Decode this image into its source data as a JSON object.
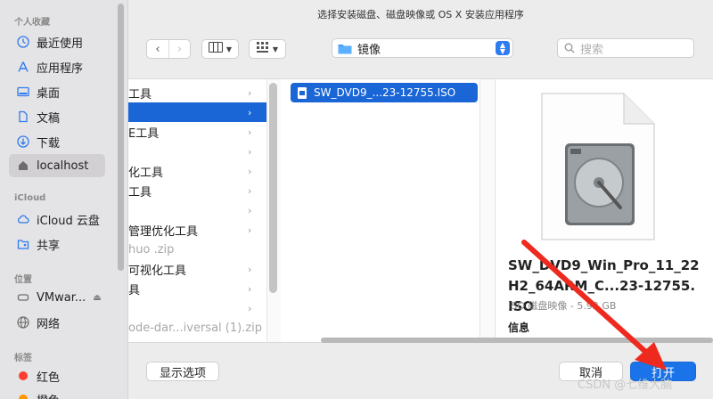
{
  "dialog": {
    "title": "选择安装磁盘、磁盘映像或 OS X 安装应用程序"
  },
  "sidebar": {
    "sections": [
      {
        "label": "个人收藏"
      },
      {
        "label": "iCloud"
      },
      {
        "label": "位置"
      },
      {
        "label": "标签"
      }
    ],
    "favorites": [
      {
        "label": "最近使用",
        "icon": "clock-icon"
      },
      {
        "label": "应用程序",
        "icon": "applications-icon"
      },
      {
        "label": "桌面",
        "icon": "desktop-icon"
      },
      {
        "label": "文稿",
        "icon": "document-icon"
      },
      {
        "label": "下载",
        "icon": "download-icon"
      },
      {
        "label": "localhost",
        "icon": "home-icon"
      }
    ],
    "icloud": [
      {
        "label": "iCloud 云盘",
        "icon": "cloud-icon"
      },
      {
        "label": "共享",
        "icon": "shared-folder-icon"
      }
    ],
    "locations": [
      {
        "label": "VMwar...",
        "icon": "disk-icon"
      },
      {
        "label": "网络",
        "icon": "network-icon"
      }
    ],
    "tags": [
      {
        "label": "红色",
        "color": "#ff3b30"
      },
      {
        "label": "橙色",
        "color": "#ff9500"
      }
    ]
  },
  "toolbar": {
    "location": "镜像",
    "search_placeholder": "搜索"
  },
  "column1": [
    {
      "label": "工具",
      "selected": false,
      "chevron": true
    },
    {
      "label": "",
      "selected": true,
      "chevron": true
    },
    {
      "label": "E工具",
      "selected": false,
      "chevron": true
    },
    {
      "label": "",
      "selected": false,
      "chevron": true
    },
    {
      "label": "化工具",
      "selected": false,
      "chevron": true
    },
    {
      "label": "工具",
      "selected": false,
      "chevron": true
    },
    {
      "label": "",
      "selected": false,
      "chevron": true
    },
    {
      "label": "管理优化工具",
      "selected": false,
      "chevron": true
    },
    {
      "label": "huo .zip",
      "selected": false,
      "chevron": false,
      "grey": true
    },
    {
      "label": "可视化工具",
      "selected": false,
      "chevron": true
    },
    {
      "label": "具",
      "selected": false,
      "chevron": true
    },
    {
      "label": "",
      "selected": false,
      "chevron": true
    },
    {
      "label": "ode-dar...iversal (1).zip",
      "selected": false,
      "chevron": false,
      "grey": true
    }
  ],
  "column2": {
    "file": "SW_DVD9_...23-12755.ISO"
  },
  "preview": {
    "name": "SW_DVD9_Win_Pro_11_22H2_64ARM_C...23-12755.ISO",
    "kind": "ISO 磁盘映像 - 5.92 GB",
    "info": "信息"
  },
  "buttons": {
    "options": "显示选项",
    "cancel": "取消",
    "open": "打开"
  },
  "watermark": "CSDN @七维大脑"
}
